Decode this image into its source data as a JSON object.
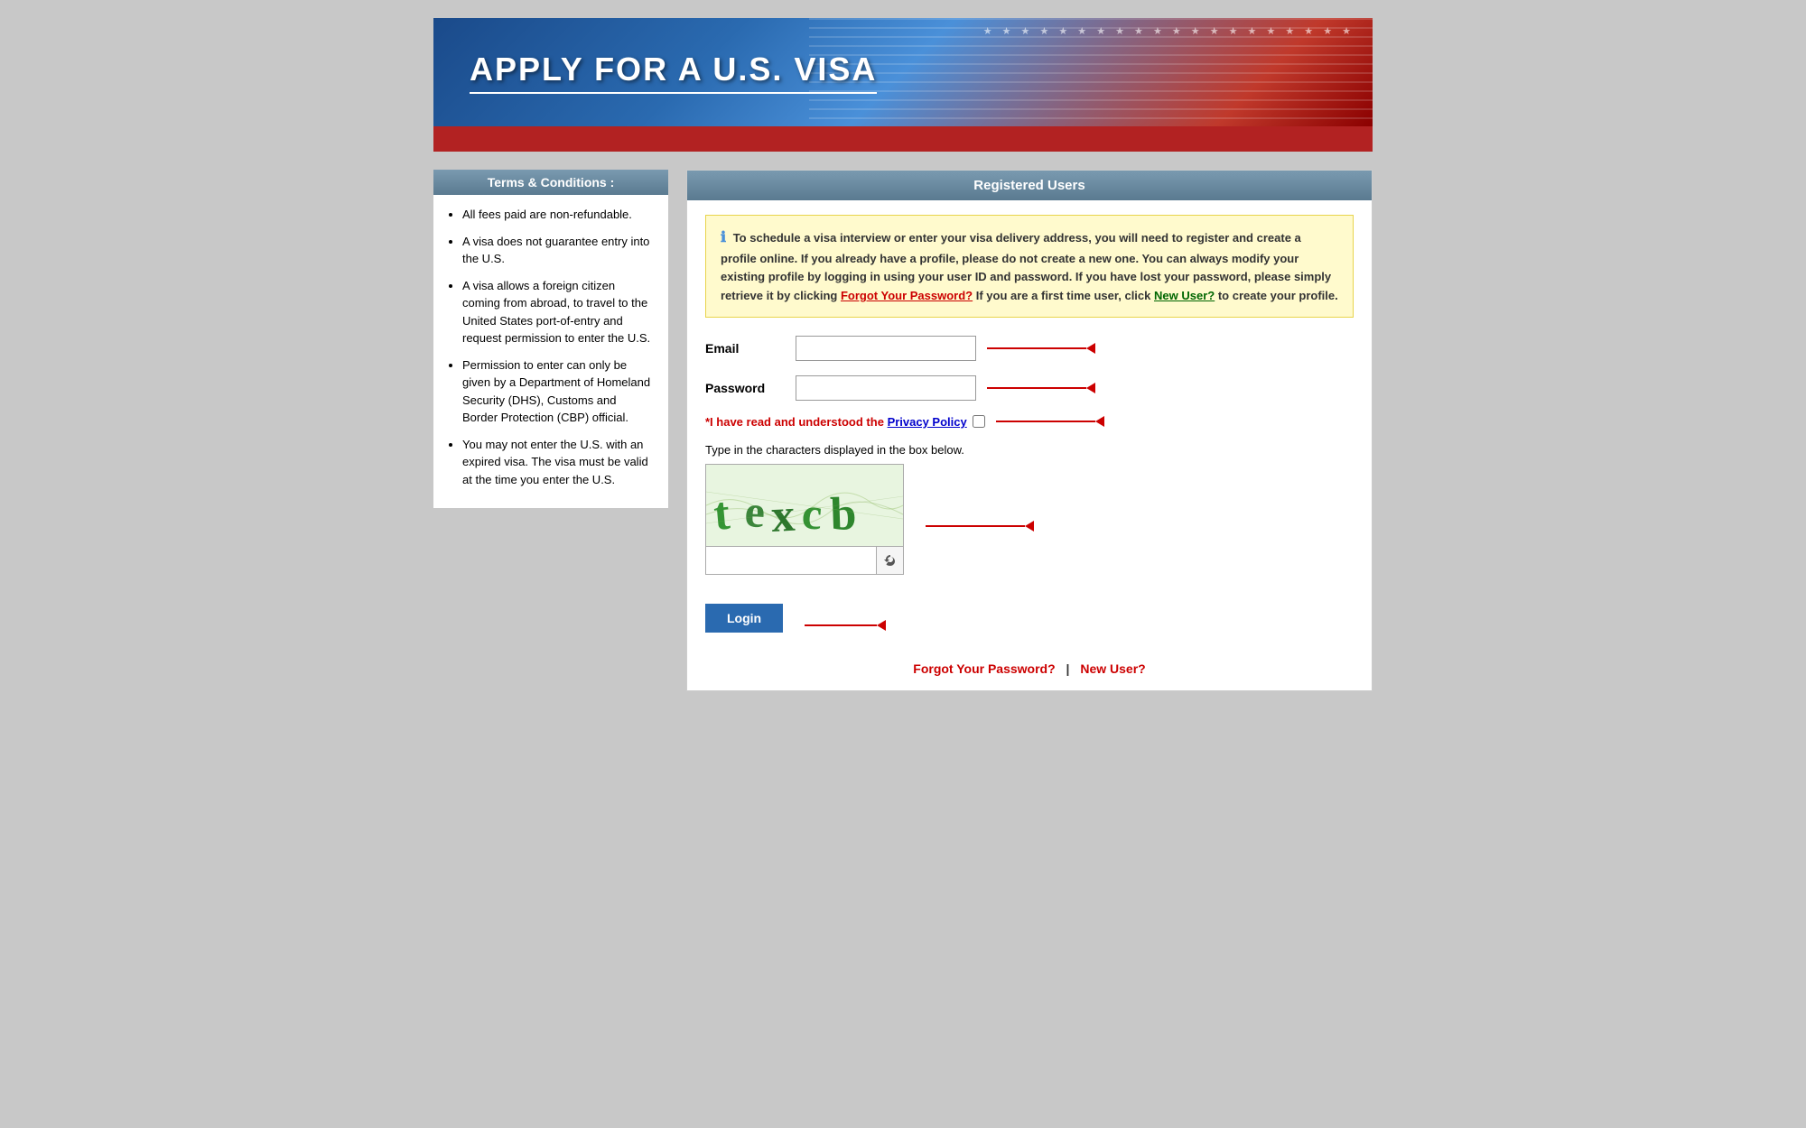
{
  "header": {
    "title": "APPLY FOR A U.S. VISA"
  },
  "terms": {
    "heading": "Terms & Conditions :",
    "items": [
      "All fees paid are non-refundable.",
      "A visa does not guarantee entry into the U.S.",
      "A visa allows a foreign citizen coming from abroad, to travel to the United States port-of-entry and request permission to enter the U.S.",
      "Permission to enter can only be given by a Department of Homeland Security (DHS), Customs and Border Protection (CBP) official.",
      "You may not enter the U.S. with an expired visa. The visa must be valid at the time you enter the U.S."
    ]
  },
  "login_panel": {
    "heading": "Registered Users",
    "notice": {
      "icon": "ℹ",
      "text_before": "To schedule a visa interview or enter your visa delivery address, you will need to register and create a profile online. If you already have a profile, please do not create a new one. You can always modify your existing profile by logging in using your user ID and password. If you have lost your password, please simply retrieve it by clicking",
      "forgot_link": "Forgot Your Password?",
      "text_middle": "If you are a first time user, click",
      "new_user_link": "New User?",
      "text_end": "to create your profile."
    },
    "email_label": "Email",
    "email_placeholder": "",
    "password_label": "Password",
    "password_placeholder": "",
    "privacy_prefix": "*I have read and understood the",
    "privacy_link": "Privacy Policy",
    "captcha_label": "Type in the characters displayed in the box below.",
    "captcha_text": "texcb",
    "login_button": "Login",
    "forgot_link": "Forgot Your Password?",
    "separator": "|",
    "new_user_link": "New User?"
  }
}
